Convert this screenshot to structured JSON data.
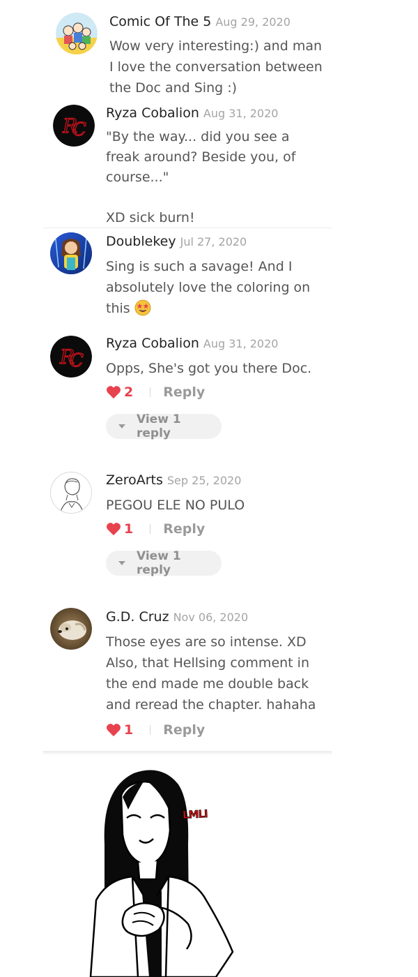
{
  "comments": [
    {
      "author": "Comic Of The 5",
      "date": "Aug 29, 2020",
      "lines": [
        "Wow very interesting:) and man",
        "I love the conversation between",
        "the Doc and Sing :)"
      ],
      "avatar_icon": "cartoon-group-avatar"
    },
    {
      "author": "Ryza Cobalion",
      "date": "Aug 31, 2020",
      "lines": [
        "\"By the way... did you see a",
        "freak around? Beside you, of",
        "course...\"",
        "",
        "XD sick burn!"
      ],
      "avatar_icon": "rc-monogram-avatar"
    },
    {
      "author": "Doublekey",
      "date": "Jul 27, 2020",
      "lines": [
        "Sing is such a savage! And I",
        "absolutely love the coloring on",
        "this"
      ],
      "emoji": "star-struck-emoji",
      "avatar_icon": "blue-character-avatar"
    },
    {
      "author": "Ryza Cobalion",
      "date": "Aug 31, 2020",
      "lines": [
        "Opps, She's got you there Doc."
      ],
      "likes": "2",
      "reply_label": "Reply",
      "view_replies_label": "View 1 reply",
      "avatar_icon": "rc-monogram-avatar"
    },
    {
      "author": "ZeroArts",
      "date": "Sep 25, 2020",
      "lines": [
        "PEGOU ELE NO PULO"
      ],
      "likes": "1",
      "reply_label": "Reply",
      "view_replies_label": "View 1 reply",
      "avatar_icon": "sketch-character-avatar"
    },
    {
      "author": "G.D. Cruz",
      "date": "Nov 06, 2020",
      "lines": [
        "Those eyes are so intense. XD",
        "Also, that Hellsing comment in",
        "the end made me double back",
        "and reread the chapter. hahaha"
      ],
      "likes": "1",
      "reply_label": "Reply",
      "avatar_icon": "dog-photo-avatar"
    }
  ],
  "colors": {
    "like": "#e8424f",
    "meta": "#a4a4a4",
    "body": "#555555",
    "sfx": "#cc1111"
  },
  "comic": {
    "sfx_text": "LMLI",
    "art_icon": "smiling-character-drawing"
  }
}
